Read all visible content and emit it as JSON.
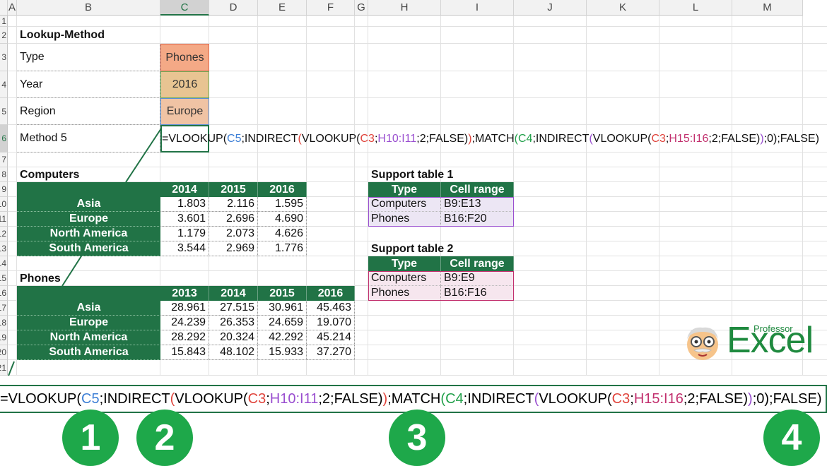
{
  "columns": [
    "A",
    "B",
    "C",
    "D",
    "E",
    "F",
    "G",
    "H",
    "I",
    "J",
    "K",
    "L",
    "M"
  ],
  "active_column": "C",
  "rows": [
    "1",
    "2",
    "3",
    "4",
    "5",
    "6",
    "7",
    "8",
    "9",
    "10",
    "11",
    "12",
    "13",
    "14",
    "15",
    "16",
    "17",
    "18",
    "19",
    "20",
    "21"
  ],
  "active_row": "6",
  "lookup": {
    "title": "Lookup-Method",
    "type_label": "Type",
    "type_value": "Phones",
    "year_label": "Year",
    "year_value": "2016",
    "region_label": "Region",
    "region_value": "Europe",
    "method_label": "Method 5",
    "colors": {
      "type": "#f4a986",
      "year": "#e8c492",
      "region": "#f0c3a4"
    }
  },
  "formula_tokens": [
    {
      "t": "=VLOOKUP(",
      "c": "plain"
    },
    {
      "t": "C5",
      "c": "blue"
    },
    {
      "t": ";INDIRECT",
      "c": "plain"
    },
    {
      "t": "(",
      "c": "red"
    },
    {
      "t": "VLOOKUP(",
      "c": "plain"
    },
    {
      "t": "C3",
      "c": "red"
    },
    {
      "t": ";",
      "c": "plain"
    },
    {
      "t": "H10:I11",
      "c": "purple"
    },
    {
      "t": ";2;FALSE)",
      "c": "plain"
    },
    {
      "t": ")",
      "c": "red"
    },
    {
      "t": ";MATCH",
      "c": "plain"
    },
    {
      "t": "(",
      "c": "green"
    },
    {
      "t": "C4",
      "c": "green"
    },
    {
      "t": ";INDIRECT",
      "c": "plain"
    },
    {
      "t": "(",
      "c": "purple"
    },
    {
      "t": "VLOOKUP(",
      "c": "plain"
    },
    {
      "t": "C3",
      "c": "red"
    },
    {
      "t": ";",
      "c": "plain"
    },
    {
      "t": "H15:I16",
      "c": "magenta"
    },
    {
      "t": ";2;FALSE)",
      "c": "plain"
    },
    {
      "t": ")",
      "c": "purple"
    },
    {
      "t": ";0)",
      "c": "plain"
    },
    {
      "t": ";FALSE)",
      "c": "plain"
    }
  ],
  "computers": {
    "title": "Computers",
    "years": [
      "2014",
      "2015",
      "2016"
    ],
    "rows": [
      {
        "region": "Asia",
        "values": [
          "1.803",
          "2.116",
          "1.595"
        ]
      },
      {
        "region": "Europe",
        "values": [
          "3.601",
          "2.696",
          "4.690"
        ]
      },
      {
        "region": "North America",
        "values": [
          "1.179",
          "2.073",
          "4.626"
        ]
      },
      {
        "region": "South America",
        "values": [
          "3.544",
          "2.969",
          "1.776"
        ]
      }
    ]
  },
  "phones": {
    "title": "Phones",
    "years": [
      "2013",
      "2014",
      "2015",
      "2016"
    ],
    "rows": [
      {
        "region": "Asia",
        "values": [
          "28.961",
          "27.515",
          "30.961",
          "45.463"
        ]
      },
      {
        "region": "Europe",
        "values": [
          "24.239",
          "26.353",
          "24.659",
          "19.070"
        ]
      },
      {
        "region": "North America",
        "values": [
          "28.292",
          "20.324",
          "42.292",
          "45.214"
        ]
      },
      {
        "region": "South America",
        "values": [
          "15.843",
          "48.102",
          "15.933",
          "37.270"
        ]
      }
    ]
  },
  "support1": {
    "title": "Support table 1",
    "headers": [
      "Type",
      "Cell range"
    ],
    "rows": [
      [
        "Computers",
        "B9:E13"
      ],
      [
        "Phones",
        "B16:F20"
      ]
    ],
    "fill": "#ece6f4",
    "border": "#9a4fd0"
  },
  "support2": {
    "title": "Support table 2",
    "headers": [
      "Type",
      "Cell range"
    ],
    "rows": [
      [
        "Computers",
        "B9:E9"
      ],
      [
        "Phones",
        "B16:F16"
      ]
    ],
    "fill": "#f6e6ee",
    "border": "#c2306e"
  },
  "logo": {
    "small": "Professor",
    "big": "Excel",
    "color": "#1f8a3f"
  },
  "callouts": [
    "1",
    "2",
    "3",
    "4"
  ],
  "theme": {
    "green": "#217346",
    "circle": "#1ea84a"
  }
}
